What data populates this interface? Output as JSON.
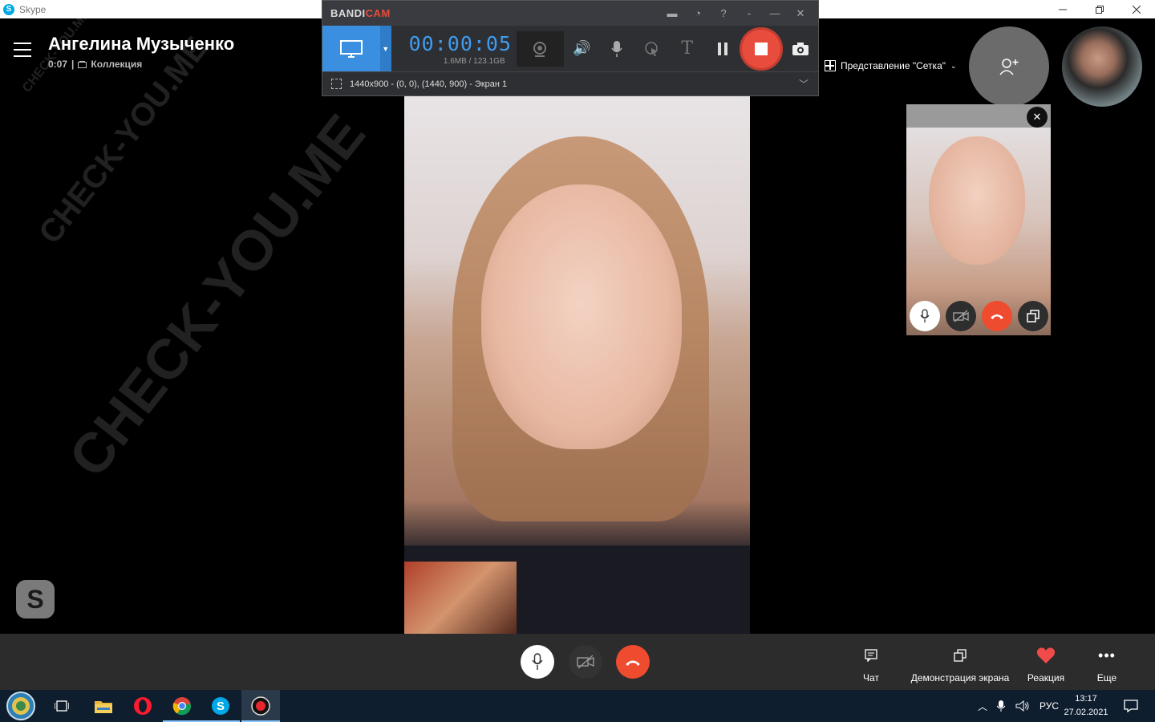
{
  "window": {
    "app_title": "Skype"
  },
  "call": {
    "contact_name": "Ангелина Музыченко",
    "duration": "0:07",
    "separator": "|",
    "collection_label": "Коллекция"
  },
  "watermark": "CHECK-YOU.ME",
  "bandicam": {
    "brand_a": "BANDI",
    "brand_b": "CAM",
    "timer": "00:00:05",
    "file_size": "1.6MB / 123.1GB",
    "region": "1440x900 - (0, 0), (1440, 900) - Экран 1",
    "help_label": "?"
  },
  "view": {
    "grid_label": "Представление \"Сетка\""
  },
  "toolbar": {
    "chat_label": "Чат",
    "share_label": "Демонстрация экрана",
    "reaction_label": "Реакция",
    "more_label": "Еще"
  },
  "taskbar": {
    "language": "РУС",
    "time": "13:17",
    "date": "27.02.2021"
  },
  "colors": {
    "end_call": "#ef4b2f",
    "bandicam_blue": "#3a8fe0",
    "reaction_heart": "#f04a4a"
  }
}
